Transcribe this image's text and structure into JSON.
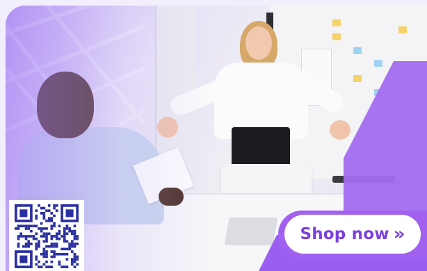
{
  "ad": {
    "cta_label": "Shop now",
    "cta_icon": "»",
    "colors": {
      "accent": "#a160f0",
      "cta_text": "#7b3fe0",
      "cta_bg": "#ffffff"
    },
    "qr_code": {
      "icon": "qr-code"
    }
  }
}
